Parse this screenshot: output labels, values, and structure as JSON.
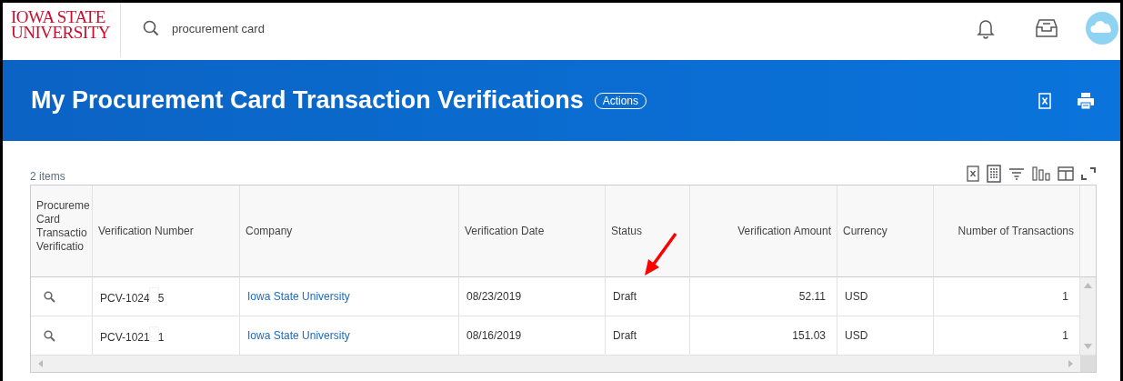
{
  "logo": {
    "line_1": "IOWA STATE",
    "line_2": "UNIVERSITY"
  },
  "search": {
    "value": "procurement card"
  },
  "banner": {
    "title": "My Procurement Card Transaction Verifications",
    "actions_button": "Actions"
  },
  "table": {
    "item_count": "2 items",
    "columns": [
      "Procureme\nCard\nTransactio\nVerificatio",
      "Verification Number",
      "Company",
      "Verification Date",
      "Status",
      "Verification Amount",
      "Currency",
      "Number of Transactions"
    ],
    "rows": [
      {
        "number_start": "PCV-1024",
        "number_end": "5",
        "company": "Iowa State University",
        "date": "08/23/2019",
        "status": "Draft",
        "amount": "52.11",
        "currency": "USD",
        "transactions": "1"
      },
      {
        "number_start": "PCV-1021",
        "number_end": "1",
        "company": "Iowa State University",
        "date": "08/16/2019",
        "status": "Draft",
        "amount": "151.03",
        "currency": "USD",
        "transactions": "1"
      }
    ]
  }
}
